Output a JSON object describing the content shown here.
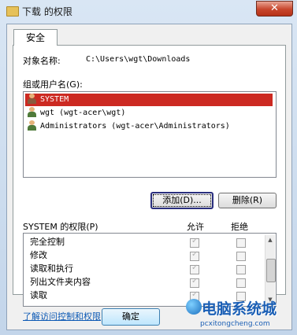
{
  "window": {
    "title": "下载 的权限",
    "close_glyph": "✕"
  },
  "tabs": [
    {
      "label": "安全"
    }
  ],
  "object": {
    "label": "对象名称:",
    "path": "C:\\Users\\wgt\\Downloads"
  },
  "principals": {
    "label": "组或用户名(G):",
    "items": [
      {
        "name": "SYSTEM",
        "icon": "user-group-icon"
      },
      {
        "name": "wgt (wgt-acer\\wgt)",
        "icon": "user-icon"
      },
      {
        "name": "Administrators (wgt-acer\\Administrators)",
        "icon": "user-group-icon"
      }
    ],
    "selected_index": 0
  },
  "buttons": {
    "add": "添加(D)...",
    "remove": "删除(R)",
    "ok": "确定"
  },
  "permissions": {
    "header": "SYSTEM 的权限(P)",
    "allow": "允许",
    "deny": "拒绝",
    "rows": [
      {
        "name": "完全控制",
        "allow": true,
        "deny": false
      },
      {
        "name": "修改",
        "allow": true,
        "deny": false
      },
      {
        "name": "读取和执行",
        "allow": true,
        "deny": false
      },
      {
        "name": "列出文件夹内容",
        "allow": true,
        "deny": false
      },
      {
        "name": "读取",
        "allow": true,
        "deny": false
      }
    ]
  },
  "help_link": "了解访问控制和权限",
  "watermark": {
    "text": "电脑系统城",
    "url": "pcxitongcheng.com"
  },
  "colors": {
    "selection": "#cc2a22",
    "link": "#0b58b4",
    "close": "#c7462c"
  }
}
